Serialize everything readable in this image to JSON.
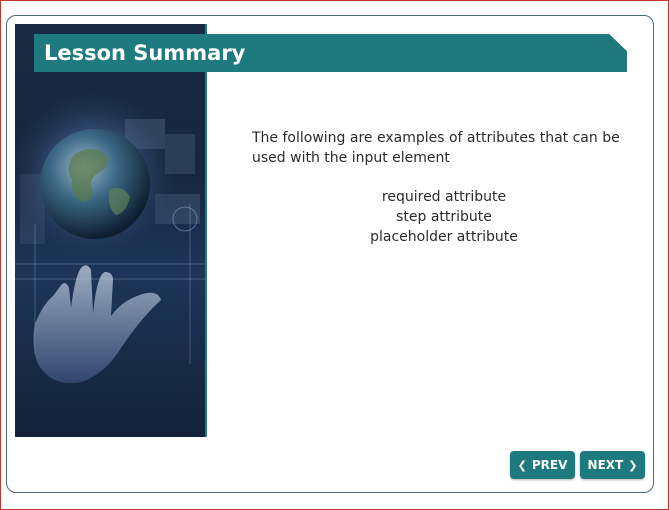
{
  "lesson": {
    "title": "Lesson Summary",
    "intro": "The following are examples of attributes that can be used with the input element",
    "attributes": [
      "required attribute",
      "step attribute",
      "placeholder attribute"
    ]
  },
  "navigation": {
    "prev_label": "PREV",
    "next_label": "NEXT"
  },
  "icons": {
    "prev": "chevron-left-icon",
    "next": "chevron-right-icon"
  },
  "colors": {
    "accent": "#1f7a80",
    "frame_border": "#c0392b",
    "card_border": "#4a6a7a",
    "text": "#2b2b2b"
  }
}
